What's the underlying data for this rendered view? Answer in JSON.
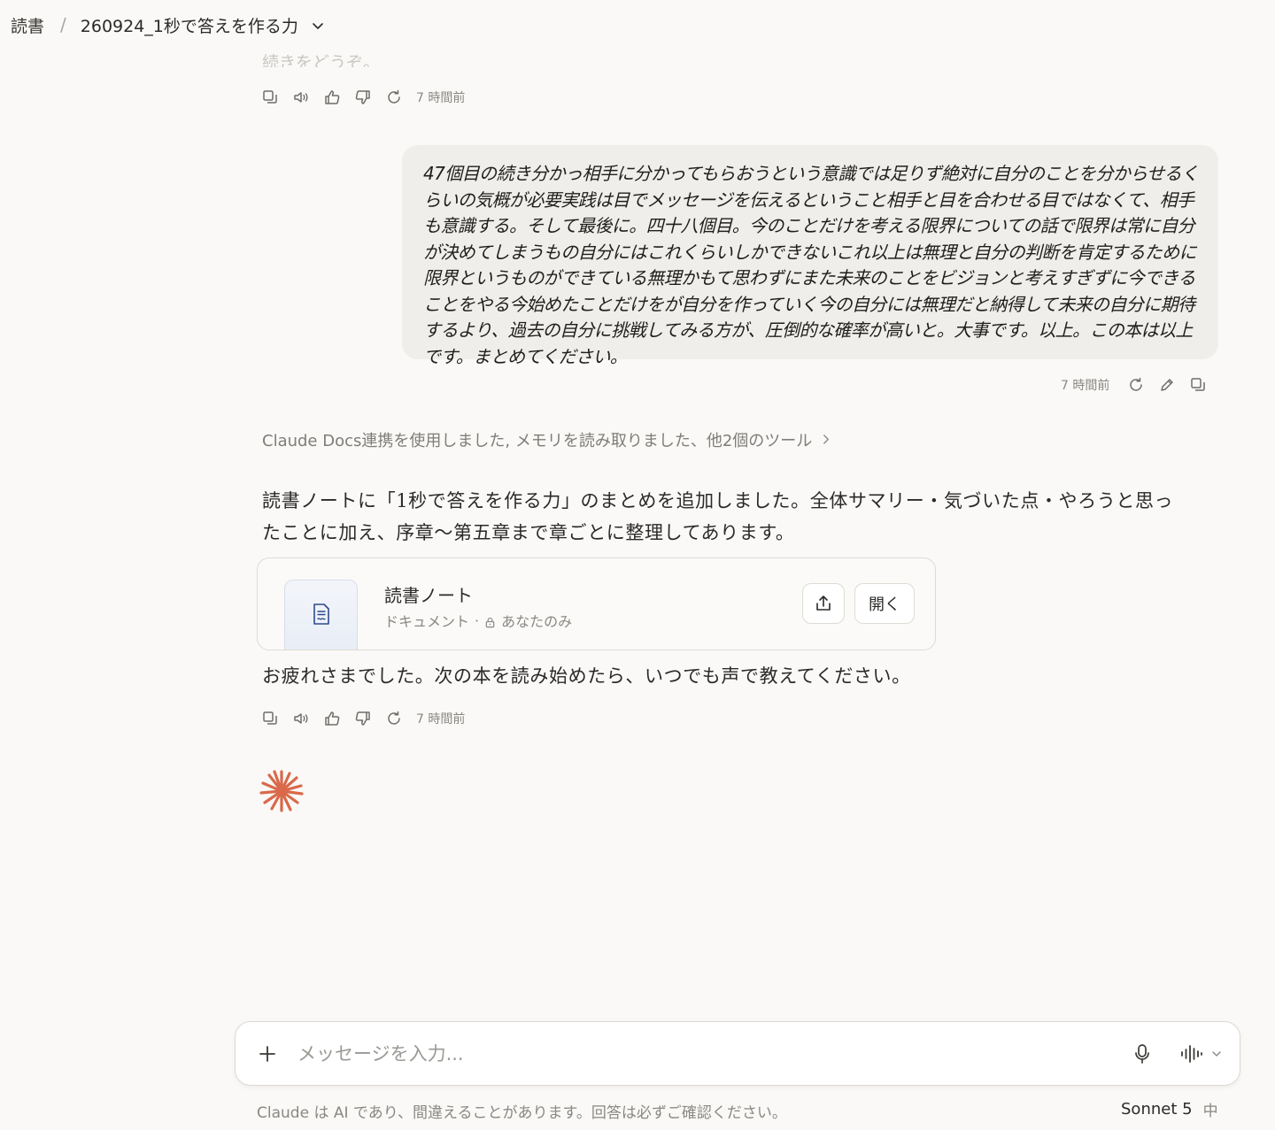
{
  "header": {
    "breadcrumb_root": "読書",
    "separator": "/",
    "chat_title": "260924_1秒で答えを作る力"
  },
  "faded_text": "続きをどうぞ。",
  "assistant_prev_actions": {
    "timestamp": "7 時間前"
  },
  "user_message": {
    "text": "47個目の続き分かっ相手に分かってもらおうという意識では足りず絶対に自分のことを分からせるくらいの気概が必要実践は目でメッセージを伝えるということ相手と目を合わせる目ではなくて、相手も意識する。そして最後に。四十八個目。今のことだけを考える限界についての話で限界は常に自分が決めてしまうもの自分にはこれくらいしかできないこれ以上は無理と自分の判断を肯定するために限界というものができている無理かもて思わずにまた未来のことをビジョンと考えすぎずに今できることをやる今始めたことだけをが自分を作っていく今の自分には無理だと納得して未来の自分に期待するより、過去の自分に挑戦してみる方が、圧倒的な確率が高いと。大事です。以上。この本は以上です。まとめてください。",
    "timestamp": "7 時間前"
  },
  "tools_line": "Claude Docs連携を使用しました, メモリを読み取りました、他2個のツール",
  "assistant_message": {
    "paragraph1": "読書ノートに「1秒で答えを作る力」のまとめを追加しました。全体サマリー・気づいた点・やろうと思ったことに加え、序章〜第五章まで章ごとに整理してあります。",
    "doc_card": {
      "title": "読書ノート",
      "type": "ドキュメント",
      "dot": "·",
      "visibility": "あなたのみ",
      "open_label": "開く"
    },
    "paragraph2": "お疲れさまでした。次の本を読み始めたら、いつでも声で教えてください。",
    "timestamp": "7 時間前"
  },
  "composer": {
    "placeholder": "メッセージを入力..."
  },
  "footer": {
    "disclaimer": "Claude は AI であり、間違えることがあります。回答は必ずご確認ください。",
    "model": "Sonnet 5",
    "effort": "中"
  },
  "colors": {
    "background": "#faf9f7",
    "user_bubble": "#f0eeea",
    "claude_spark": "#d9694a",
    "doc_icon": "#2d4a8a"
  }
}
